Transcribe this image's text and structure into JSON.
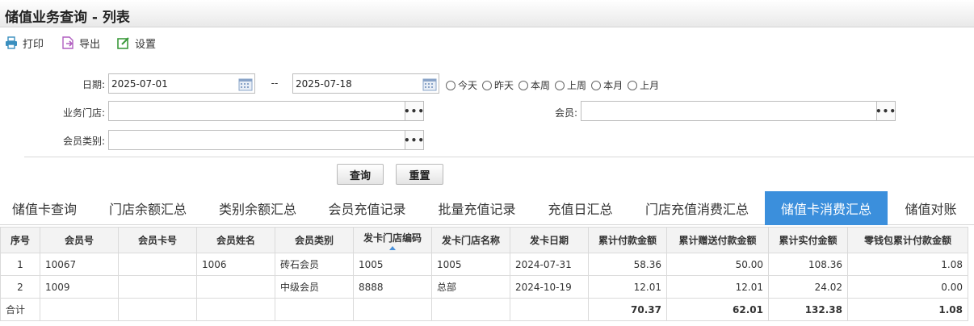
{
  "title": "储值业务查询 - 列表",
  "toolbar": {
    "print": "打印",
    "export": "导出",
    "settings": "设置"
  },
  "form": {
    "date_label": "日期:",
    "date_from": "2025-07-01",
    "date_sep": "--",
    "date_to": "2025-07-18",
    "quick_dates": [
      "今天",
      "昨天",
      "本周",
      "上周",
      "本月",
      "上月"
    ],
    "store_label": "业务门店:",
    "store_value": "",
    "member_label": "会员:",
    "member_value": "",
    "member_type_label": "会员类别:",
    "member_type_value": "",
    "picker_label": "•••",
    "query_button": "查询",
    "reset_button": "重置"
  },
  "tabs": [
    "储值卡查询",
    "门店余额汇总",
    "类别余额汇总",
    "会员充值记录",
    "批量充值记录",
    "充值日汇总",
    "门店充值消费汇总",
    "储值卡消费汇总",
    "储值对账"
  ],
  "active_tab": "储值卡消费汇总",
  "table": {
    "columns": [
      "序号",
      "会员号",
      "会员卡号",
      "会员姓名",
      "会员类别",
      "发卡门店编码",
      "发卡门店名称",
      "发卡日期",
      "累计付款金额",
      "累计赠送付款金额",
      "累计实付金额",
      "零钱包累计付款金额"
    ],
    "rows": [
      [
        "1",
        "10067",
        "",
        "1006",
        "砖石会员",
        "1005",
        "1005",
        "2024-07-31",
        "58.36",
        "50.00",
        "108.36",
        "1.08"
      ],
      [
        "2",
        "1009",
        "",
        "",
        "中级会员",
        "8888",
        "总部",
        "2024-10-19",
        "12.01",
        "12.01",
        "24.02",
        "0.00"
      ]
    ],
    "total": [
      "合计",
      "",
      "",
      "",
      "",
      "",
      "",
      "",
      "70.37",
      "62.01",
      "132.38",
      "1.08"
    ]
  },
  "colors": {
    "accent": "#3b8fdc",
    "sort_arrow": "#4a90d9"
  }
}
